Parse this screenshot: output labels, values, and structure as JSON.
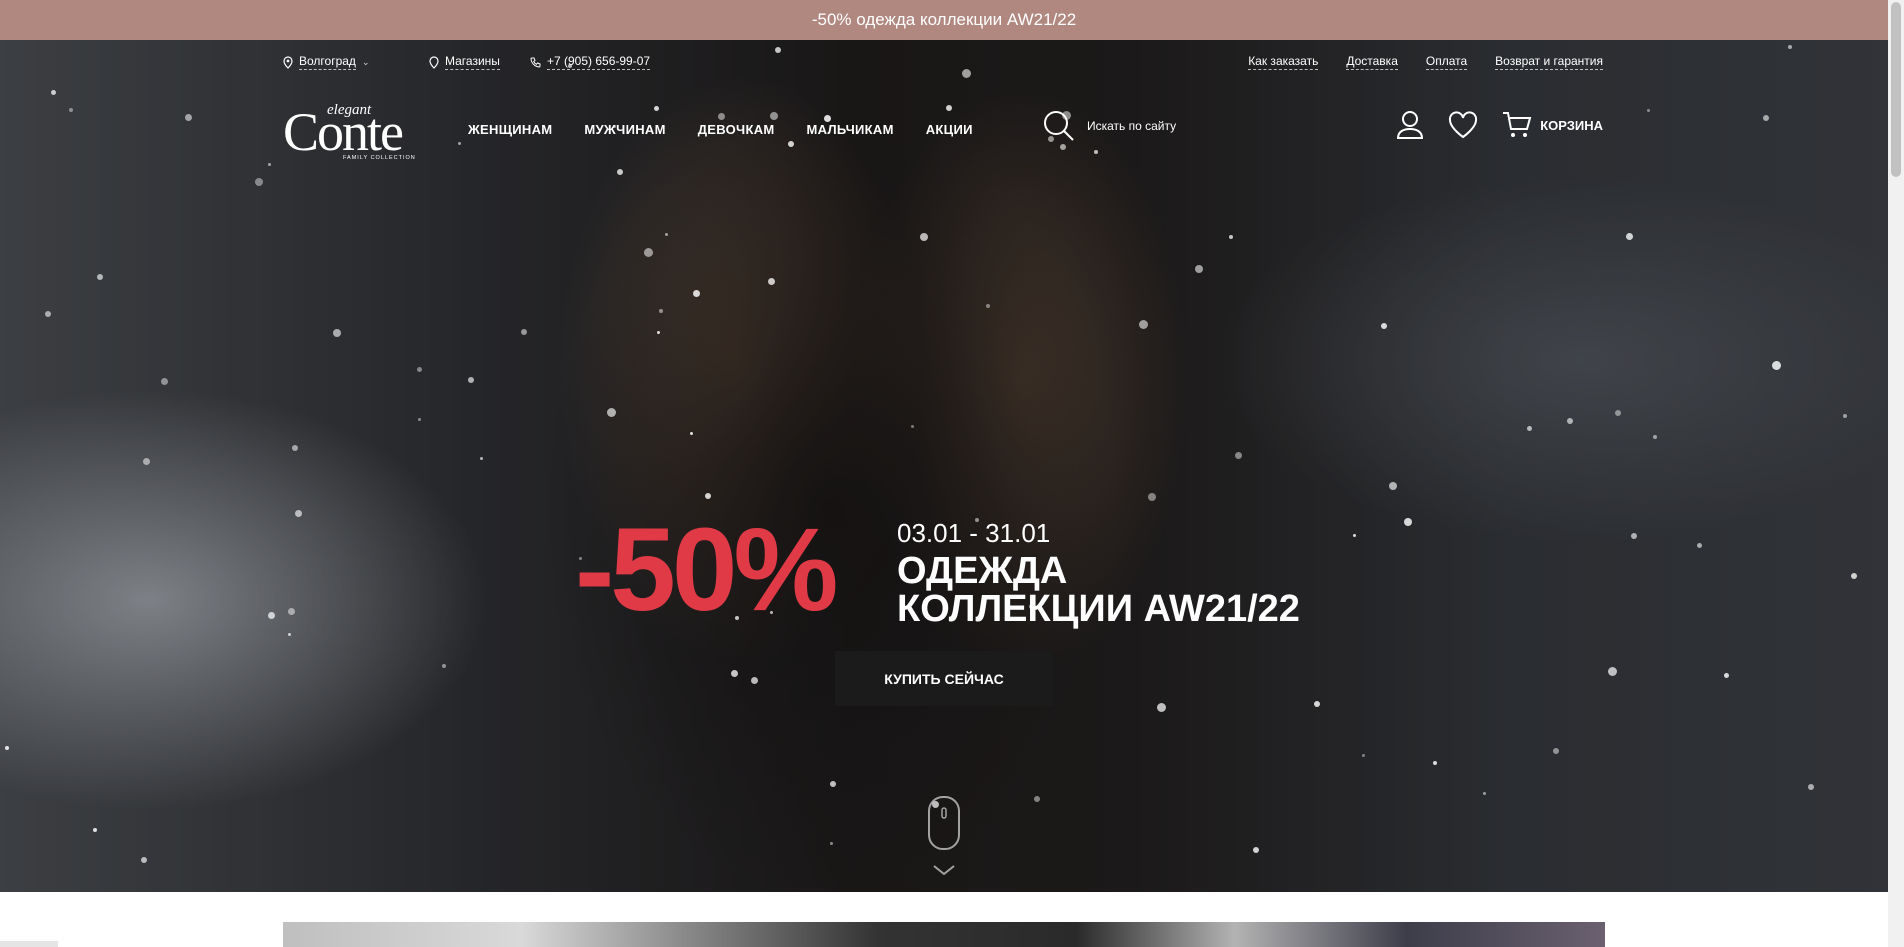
{
  "promo_bar": {
    "text": "-50% одежда коллекции AW21/22"
  },
  "utility": {
    "city": "Волгоград",
    "stores": "Магазины",
    "phone": "+7 (905) 656-99-07",
    "links": [
      "Как заказать",
      "Доставка",
      "Оплата",
      "Возврат и гарантия"
    ]
  },
  "logo": {
    "top": "elegant",
    "main": "Conte",
    "sub": "FAMILY COLLECTION"
  },
  "nav": [
    "ЖЕНЩИНАМ",
    "МУЖЧИНАМ",
    "ДЕВОЧКАМ",
    "МАЛЬЧИКАМ",
    "АКЦИИ"
  ],
  "search": {
    "placeholder": "Искать по сайту"
  },
  "cart": {
    "label": "КОРЗИНА"
  },
  "banner": {
    "discount": "-50%",
    "dates": "03.01 - 31.01",
    "headline_line1": "ОДЕЖДА",
    "headline_line2": "КОЛЛЕКЦИИ AW21/22",
    "button": "КУПИТЬ СЕЙЧАС"
  },
  "colors": {
    "promo_bg": "#b08880",
    "discount": "#e03a47",
    "button_bg": "#1b1b1b"
  },
  "icons": [
    "location-pin-icon",
    "chevron-down-icon",
    "store-pin-icon",
    "phone-icon",
    "search-icon",
    "user-icon",
    "heart-icon",
    "cart-icon",
    "mouse-scroll-icon",
    "chevron-down-icon"
  ]
}
